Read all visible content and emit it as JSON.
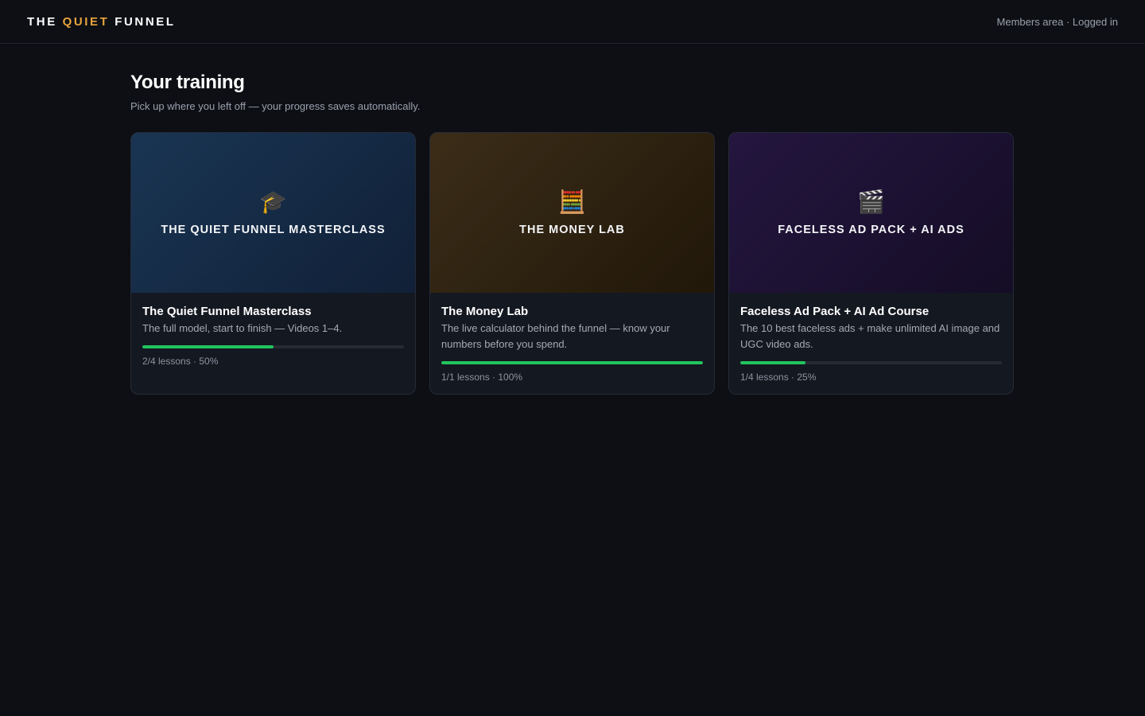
{
  "header": {
    "brand_prefix": "THE",
    "brand_accent": "QUIET",
    "brand_suffix": "FUNNEL",
    "status": "Members area · Logged in"
  },
  "main": {
    "title": "Your training",
    "subtitle": "Pick up where you left off — your progress saves automatically."
  },
  "courses": [
    {
      "cover_icon": "🎓",
      "cover_icon_name": "graduation-cap-icon",
      "cover_title": "THE QUIET FUNNEL MASTERCLASS",
      "name": "The Quiet Funnel Masterclass",
      "description": "The full model, start to finish — Videos 1–4.",
      "progress_percent": 50,
      "progress_text": "2/4 lessons · 50%",
      "theme": "blue"
    },
    {
      "cover_icon": "🧮",
      "cover_icon_name": "abacus-icon",
      "cover_title": "THE MONEY LAB",
      "name": "The Money Lab",
      "description": "The live calculator behind the funnel — know your numbers before you spend.",
      "progress_percent": 100,
      "progress_text": "1/1 lessons · 100%",
      "theme": "amber"
    },
    {
      "cover_icon": "🎬",
      "cover_icon_name": "clapperboard-icon",
      "cover_title": "FACELESS AD PACK + AI ADS",
      "name": "Faceless Ad Pack + AI Ad Course",
      "description": "The 10 best faceless ads + make unlimited AI image and UGC video ads.",
      "progress_percent": 25,
      "progress_text": "1/4 lessons · 25%",
      "theme": "purple"
    }
  ],
  "colors": {
    "background": "#0d0f14",
    "accent": "#e8a33d",
    "progress": "#22c55e"
  }
}
